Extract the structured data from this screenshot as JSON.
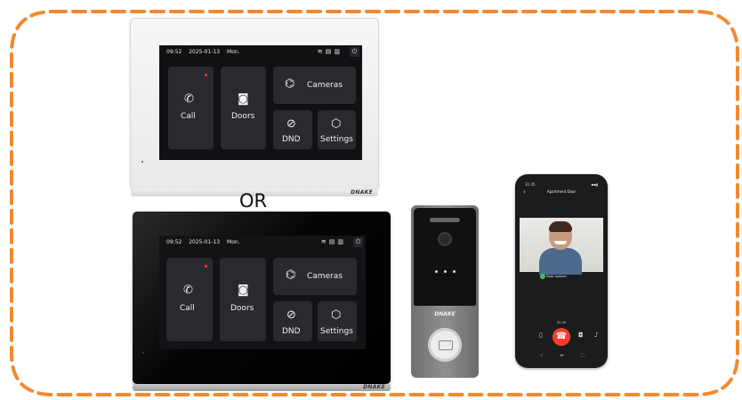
{
  "colors": {
    "dashed_frame": "#f28a2e",
    "screen_bg": "#111114",
    "tile_bg": "#2a2a2e",
    "notification_dot": "#ff3b30",
    "hangup": "#ff3b30",
    "door_opened_indicator": "#34c759"
  },
  "monitors": [
    {
      "finish": "white",
      "brand": "DNAKE",
      "status": {
        "time": "09:52",
        "date": "2025-01-13",
        "weekday": "Mon."
      },
      "status_icons": [
        "wifi-icon",
        "sd-card-icon",
        "document-icon"
      ],
      "power_icon": "power-icon",
      "tiles": {
        "call": {
          "label": "Call",
          "icon": "phone-icon",
          "has_notification": true
        },
        "doors": {
          "label": "Doors",
          "icon": "intercom-icon"
        },
        "cameras": {
          "label": "Cameras",
          "icon": "cctv-camera-icon"
        },
        "dnd": {
          "label": "DND",
          "icon": "do-not-disturb-icon"
        },
        "settings": {
          "label": "Settings",
          "icon": "settings-hexagon-icon"
        }
      }
    },
    {
      "finish": "black",
      "brand": "DNAKE",
      "status": {
        "time": "09:52",
        "date": "2025-01-13",
        "weekday": "Mon."
      },
      "status_icons": [
        "wifi-icon",
        "sd-card-icon",
        "document-icon"
      ],
      "power_icon": "power-icon",
      "tiles": {
        "call": {
          "label": "Call",
          "icon": "phone-icon",
          "has_notification": true
        },
        "doors": {
          "label": "Doors",
          "icon": "intercom-icon"
        },
        "cameras": {
          "label": "Cameras",
          "icon": "cctv-camera-icon"
        },
        "dnd": {
          "label": "DND",
          "icon": "do-not-disturb-icon"
        },
        "settings": {
          "label": "Settings",
          "icon": "settings-hexagon-icon"
        }
      }
    }
  ],
  "or_label": "OR",
  "door_station": {
    "brand": "DNAKE",
    "icons": [
      "camera-lens-icon",
      "card-reader-icon"
    ]
  },
  "phone": {
    "status_time": "11:45",
    "title": "Apartment Door",
    "back_icon": "chevron-left-icon",
    "door_status": "Door opened",
    "timer": "00:06",
    "controls": [
      "phone-icon",
      "hangup-icon",
      "camera-icon",
      "mic-icon"
    ],
    "nav_icons": [
      "nav-back-icon",
      "nav-home-icon",
      "nav-recent-icon"
    ]
  }
}
